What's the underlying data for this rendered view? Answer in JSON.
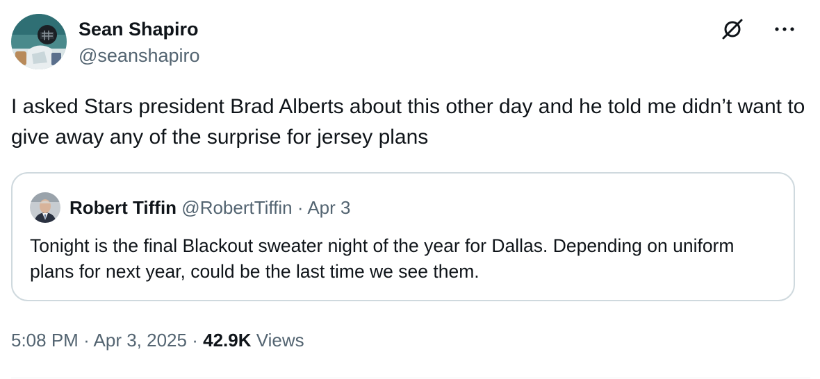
{
  "author": {
    "display_name": "Sean Shapiro",
    "handle": "@seanshapiro"
  },
  "actions": {
    "grok_icon": "grok-icon",
    "more_icon": "more-horizontal-icon"
  },
  "tweet": {
    "text": "I asked Stars president Brad Alberts about this other day and he told me didn’t want to give away any of the surprise for jersey plans"
  },
  "quoted_tweet": {
    "display_name": "Robert Tiffin",
    "handle": "@RobertTiffin",
    "separator": "·",
    "date": "Apr 3",
    "text": "Tonight is the final Blackout sweater night of the year for Dallas. Depending on uniform plans for next year, could be the last time we see them."
  },
  "meta": {
    "time": "5:08 PM",
    "separator": "·",
    "date": "Apr 3, 2025",
    "views_count": "42.9K",
    "views_label": "Views"
  },
  "colors": {
    "text_primary": "#0f1419",
    "text_secondary": "#536471",
    "border": "#cfd9de"
  }
}
